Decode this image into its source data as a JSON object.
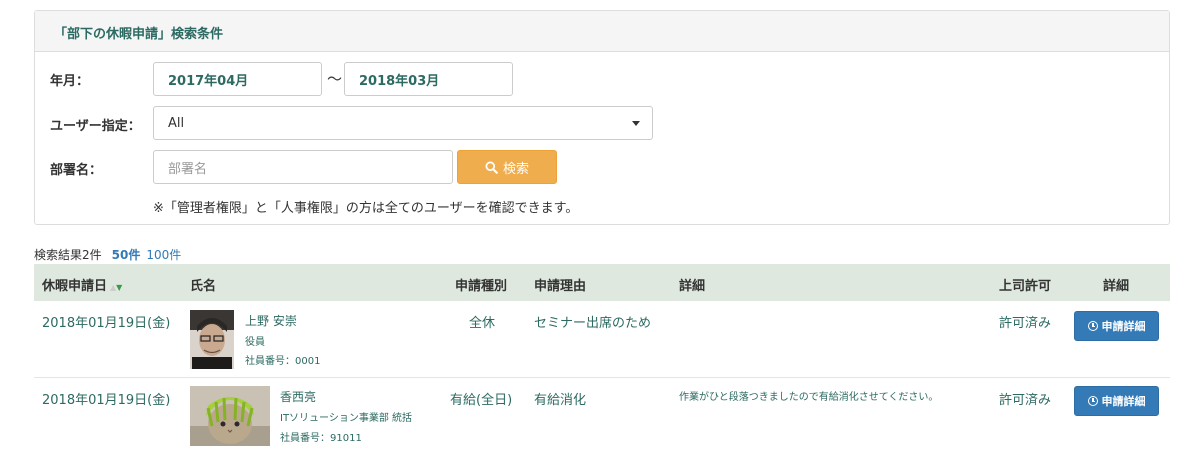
{
  "panel": {
    "title": "「部下の休暇申請」検索条件",
    "year_month_label": "年月：",
    "from": "2017年04月",
    "tilde": "～",
    "to": "2018年03月",
    "user_label": "ユーザー指定：",
    "user_value": "All",
    "dept_label": "部署名：",
    "dept_placeholder": "部署名",
    "search_button": "検索",
    "note": "※「管理者権限」と「人事権限」の方は全てのユーザーを確認できます。"
  },
  "results": {
    "count_text": "検索結果2件",
    "page_size_50": "50件",
    "page_size_100": "100件"
  },
  "table": {
    "headers": {
      "date": "休暇申請日",
      "name": "氏名",
      "type": "申請種別",
      "reason": "申請理由",
      "detail": "詳細",
      "approval": "上司許可",
      "action": "詳細"
    },
    "rows": [
      {
        "date": "2018年01月19日(金)",
        "name": "上野 安崇",
        "position": "役員",
        "employee_no": "社員番号：0001",
        "type": "全休",
        "reason": "セミナー出席のため",
        "detail": "",
        "approval": "許可済み",
        "button": "申請詳細"
      },
      {
        "date": "2018年01月19日(金)",
        "name": "香西亮",
        "position": "ITソリューション事業部 統括",
        "employee_no": "社員番号：91011",
        "type": "有給(全日)",
        "reason": "有給消化",
        "detail": "作業がひと段落つきましたので有給消化させてください。",
        "approval": "許可済み",
        "button": "申請詳細"
      }
    ]
  },
  "colors": {
    "accent_text": "#2c6a62",
    "header_bg": "#dfe8df",
    "search_button": "#f0ad4e",
    "detail_button": "#337ab7"
  }
}
